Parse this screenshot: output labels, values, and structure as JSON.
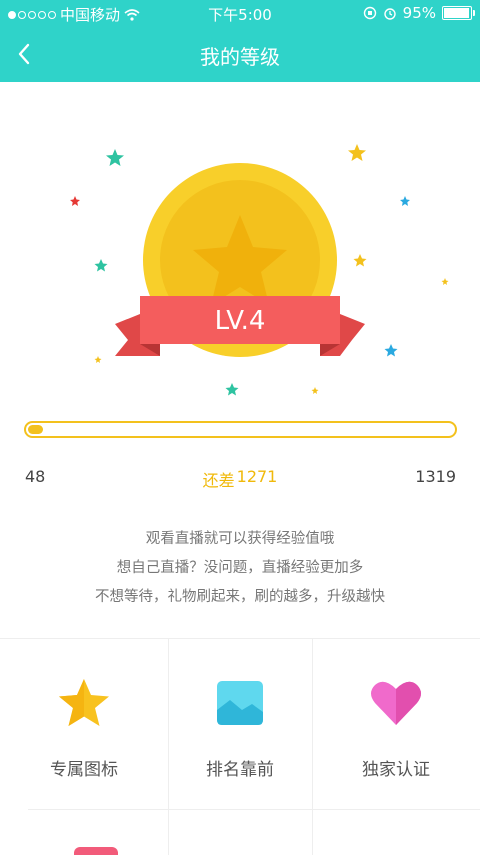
{
  "status_bar": {
    "carrier": "中国移动",
    "time": "下午5:00",
    "battery": "95%",
    "battery_level": 0.95
  },
  "nav": {
    "title": "我的等级"
  },
  "medal": {
    "level": "LV.4"
  },
  "progress": {
    "current": "48",
    "target": "1319",
    "remaining_prefix": "还差",
    "remaining_value": "1271",
    "fraction": 0.036
  },
  "description": [
    "观看直播就可以获得经验值哦",
    "想自己直播？没问题，直播经验更加多",
    "不想等待，礼物刷起来，刷的越多，升级越快"
  ],
  "privileges": [
    {
      "label": "专属图标",
      "icon": "star-icon"
    },
    {
      "label": "排名靠前",
      "icon": "picture-icon"
    },
    {
      "label": "独家认证",
      "icon": "heart-icon"
    }
  ],
  "colors": {
    "accent": "#2fd3c9",
    "gold": "#f3c11d",
    "ribbon": "#f25b5b"
  }
}
